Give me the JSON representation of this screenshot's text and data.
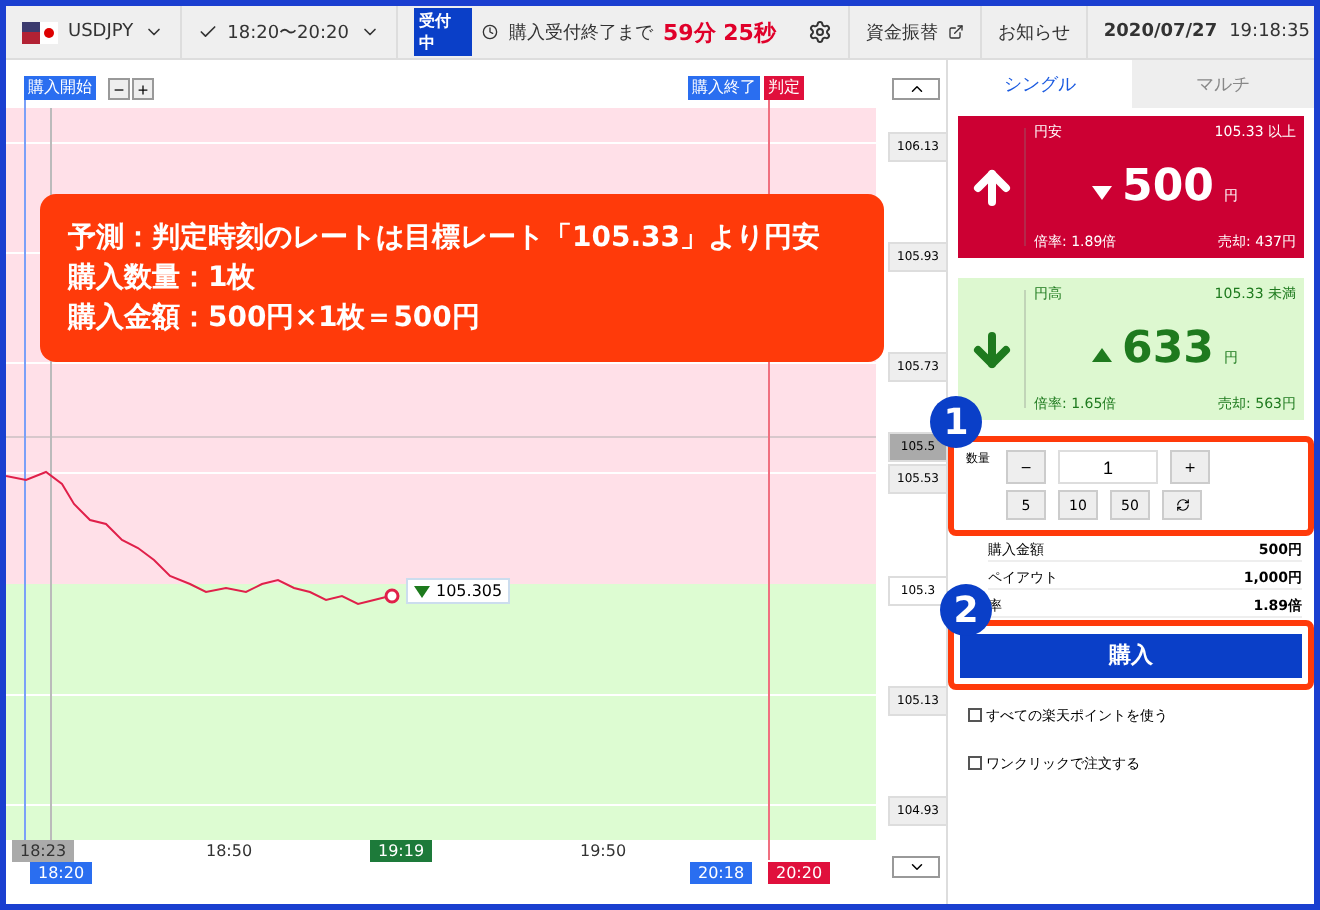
{
  "header": {
    "symbol": "USDJPY",
    "session": "18:20〜20:20",
    "status": "受付中",
    "countdown_label": "購入受付終了まで",
    "countdown": "59分 25秒",
    "links": [
      "資金振替",
      "お知らせ"
    ],
    "date": "2020/07/27",
    "time": "19:18:35"
  },
  "chart": {
    "markers": [
      {
        "label": "購入開始",
        "kind": "start"
      },
      {
        "label": "購入終了",
        "kind": "end"
      },
      {
        "label": "判定",
        "kind": "judge"
      }
    ],
    "zoom_buttons": [
      "−",
      "+"
    ],
    "price_labels": [
      {
        "text": "106.13",
        "kind": "axis"
      },
      {
        "text": "105.93",
        "kind": "axis"
      },
      {
        "text": "105.73",
        "kind": "axis"
      },
      {
        "text": "105.5",
        "kind": "target"
      },
      {
        "text": "105.53",
        "kind": "axis"
      },
      {
        "text": "105.3",
        "kind": "current"
      },
      {
        "text": "105.13",
        "kind": "axis"
      },
      {
        "text": "104.93",
        "kind": "axis"
      }
    ],
    "current_price": "105.305",
    "time_labels": [
      {
        "text": "18:23",
        "kind": "first"
      },
      {
        "text": "18:20",
        "kind": "start"
      },
      {
        "text": "18:50",
        "kind": "plain"
      },
      {
        "text": "19:19",
        "kind": "now"
      },
      {
        "text": "19:50",
        "kind": "plain"
      },
      {
        "text": "20:18",
        "kind": "end"
      },
      {
        "text": "20:20",
        "kind": "judge"
      }
    ]
  },
  "callout": {
    "lines": [
      "予測：判定時刻のレートは目標レート「105.33」より円安",
      "購入数量：1枚",
      "購入金額：500円×1枚＝500円"
    ]
  },
  "tabs": [
    {
      "label": "シングル",
      "selected": true
    },
    {
      "label": "マルチ",
      "selected": false
    }
  ],
  "options": [
    {
      "kind": "up",
      "condition": "円安",
      "threshold": "105.33 以上",
      "price": "500",
      "unit": "円",
      "rate": "倍率: 1.89倍",
      "sell": "売却: 437円"
    },
    {
      "kind": "down",
      "condition": "円高",
      "threshold": "105.33 未満",
      "price": "633",
      "unit": "円",
      "rate": "倍率: 1.65倍",
      "sell": "売却: 563円"
    }
  ],
  "quantity": {
    "label": "数量",
    "value": "1",
    "minus": "−",
    "plus": "+",
    "presets": [
      "5",
      "10",
      "50"
    ]
  },
  "summary": [
    {
      "label": "購入金額",
      "value": "500円"
    },
    {
      "label": "ペイアウト",
      "value": "1,000円"
    },
    {
      "label": "率",
      "value": "1.89倍"
    }
  ],
  "buy_button": "購入",
  "checkboxes": [
    {
      "label": "すべての楽天ポイントを使う",
      "checked": false
    },
    {
      "label": "ワンクリックで注文する",
      "checked": false
    }
  ],
  "steps": [
    "1",
    "2"
  ]
}
